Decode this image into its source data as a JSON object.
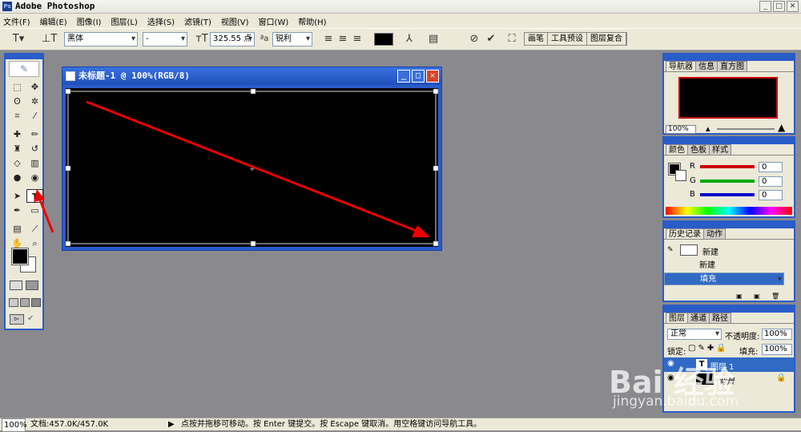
{
  "app": {
    "title": "Adobe Photoshop"
  },
  "menu": [
    "文件(F)",
    "编辑(E)",
    "图像(I)",
    "图层(L)",
    "选择(S)",
    "滤镜(T)",
    "视图(V)",
    "窗口(W)",
    "帮助(H)"
  ],
  "options": {
    "font_family": "黑体",
    "font_style": "-",
    "font_size": "325.55 点",
    "aa_label": "a",
    "antialias": "锐利",
    "text_color": "#000000"
  },
  "palette_tabs": [
    "画笔",
    "工具预设",
    "图层复合"
  ],
  "document": {
    "title": "未标题-1 @ 100%(RGB/8)"
  },
  "navigator": {
    "tabs": [
      "导航器",
      "信息",
      "直方图"
    ],
    "zoom": "100%"
  },
  "color": {
    "tabs": [
      "颜色",
      "色板",
      "样式"
    ],
    "channels": [
      {
        "label": "R",
        "value": "0",
        "color": "#cc0000"
      },
      {
        "label": "G",
        "value": "0",
        "color": "#00aa00"
      },
      {
        "label": "B",
        "value": "0",
        "color": "#0000cc"
      }
    ]
  },
  "history": {
    "tabs": [
      "历史记录",
      "动作"
    ],
    "snapshot": "新建",
    "items": [
      "新建",
      "填充"
    ]
  },
  "layers": {
    "tabs": [
      "图层",
      "通道",
      "路径"
    ],
    "blend_mode": "正常",
    "opacity_label": "不透明度:",
    "opacity": "100%",
    "lock_label": "锁定:",
    "fill_label": "填充:",
    "fill": "100%",
    "layer1": "图层 1",
    "background": "背景"
  },
  "status": {
    "zoom": "100%",
    "doc": "文档:457.0K/457.0K",
    "hint": "点按并拖移可移动。按 Enter 键提交。按 Escape 键取消。用空格键访问导航工具。"
  },
  "watermark": {
    "brand": "Bai 经验",
    "url": "jingyan.baidu.com"
  }
}
